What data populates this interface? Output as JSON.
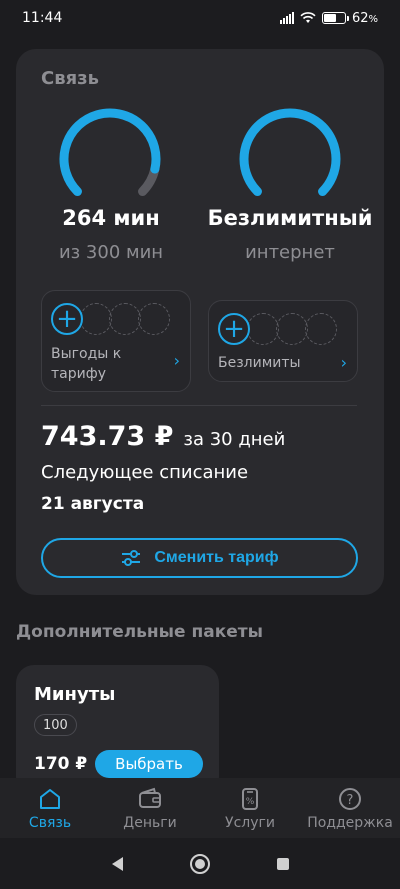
{
  "status": {
    "time": "11:44",
    "battery": "62"
  },
  "card": {
    "title": "Связь",
    "minutes": {
      "value": "264 мин",
      "sub": "из 300 мин",
      "fraction_used": 0.88
    },
    "internet": {
      "value": "Безлимитный",
      "sub": "интернет",
      "fraction_used": 1.0
    },
    "benefits": {
      "tariff_label_line1": "Выгоды к",
      "tariff_label_line2": "тарифу",
      "unlimited_label": "Безлимиты",
      "plus": "+",
      "chevron": "›"
    },
    "price": "743.73 ₽",
    "period": "за 30 дней",
    "next_label": "Следующее списание",
    "next_date": "21 августа",
    "change_button": "Сменить тариф"
  },
  "packages": {
    "section_title": "Дополнительные пакеты",
    "items": [
      {
        "title": "Минуты",
        "chip": "100",
        "price": "170 ₽",
        "button": "Выбрать"
      }
    ]
  },
  "nav": {
    "items": [
      {
        "label": "Связь",
        "icon": "home-icon",
        "active": true
      },
      {
        "label": "Деньги",
        "icon": "wallet-icon",
        "active": false
      },
      {
        "label": "Услуги",
        "icon": "services-icon",
        "active": false
      },
      {
        "label": "Поддержка",
        "icon": "help-icon",
        "active": false
      }
    ]
  },
  "colors": {
    "accent": "#1fa7e6",
    "background": "#1c1c1f",
    "card": "#2a2a2e",
    "muted": "#8e8e93"
  }
}
